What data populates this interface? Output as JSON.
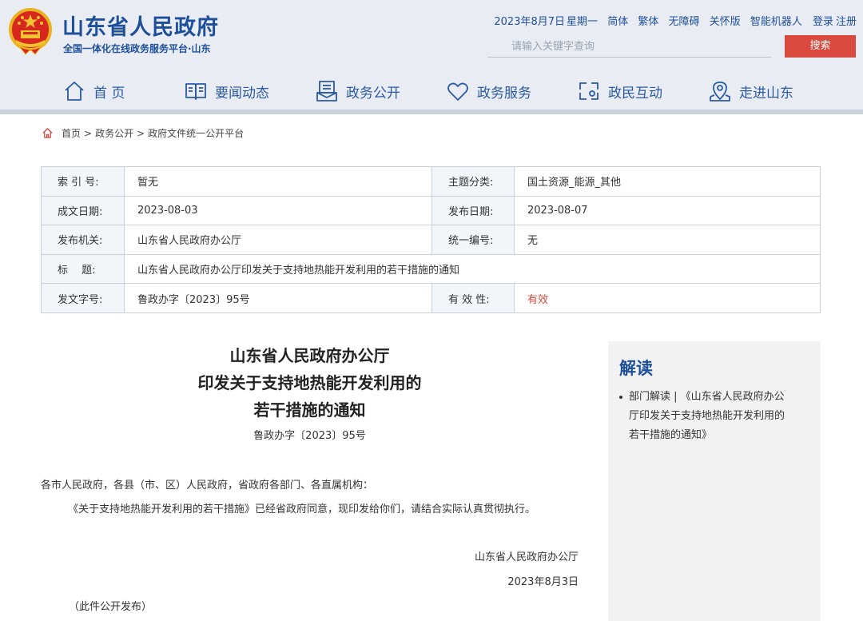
{
  "header": {
    "site_title": "山东省人民政府",
    "site_subtitle": "全国一体化在线政务服务平台·山东",
    "date": "2023年8月7日",
    "weekday": "星期一",
    "links": [
      "简体",
      "繁体",
      "无障碍",
      "关怀版",
      "智能机器人"
    ],
    "login": "登录",
    "register": "注册",
    "search_placeholder": "请输入关键字查询",
    "search_button": "搜索"
  },
  "nav": {
    "items": [
      {
        "label": "首 页",
        "icon": "home-icon"
      },
      {
        "label": "要闻动态",
        "icon": "news-icon"
      },
      {
        "label": "政务公开",
        "icon": "open-gov-icon"
      },
      {
        "label": "政务服务",
        "icon": "heart-service-icon"
      },
      {
        "label": "政民互动",
        "icon": "interaction-icon"
      },
      {
        "label": "走进山东",
        "icon": "location-icon"
      }
    ]
  },
  "breadcrumb": {
    "icon": "home-icon",
    "items": [
      "首页",
      "政务公开",
      "政府文件统一公开平台"
    ],
    "separator": ">"
  },
  "info": {
    "index_label": "索 引 号:",
    "index_value": "暂无",
    "topic_label": "主题分类:",
    "topic_value": "国土资源_能源_其他",
    "written_label": "成文日期:",
    "written_value": "2023-08-03",
    "published_label": "发布日期:",
    "published_value": "2023-08-07",
    "issuer_label": "发布机关:",
    "issuer_value": "山东省人民政府办公厅",
    "serial_label": "统一编号:",
    "serial_value": "无",
    "title_label": "标　 题:",
    "title_value": "山东省人民政府办公厅印发关于支持地热能开发利用的若干措施的通知",
    "docno_label": "发文字号:",
    "docno_value": "鲁政办字〔2023〕95号",
    "validity_label": "有 效 性:",
    "validity_value": "有效",
    "validity_color": "#d9493e"
  },
  "document": {
    "title_line1": "山东省人民政府办公厅",
    "title_line2": "印发关于支持地热能开发利用的",
    "title_line3": "若干措施的通知",
    "number": "鲁政办字〔2023〕95号",
    "addressee": "各市人民政府，各县（市、区）人民政府，省政府各部门、各直属机构：",
    "body": "《关于支持地热能开发利用的若干措施》已经省政府同意，现印发给你们，请结合实际认真贯彻执行。",
    "signer": "山东省人民政府办公厅",
    "date": "2023年8月3日",
    "note": "（此件公开发布）"
  },
  "side": {
    "title": "解读",
    "item_line1": "部门解读 | 《山东省人民政府办公",
    "item_line2": "厅印发关于支持地热能开发利用的",
    "item_line3": "若干措施的通知》"
  },
  "colors": {
    "brand_blue": "#1e4f9a",
    "accent_red": "#d9493e",
    "header_bg": "#e9edf3"
  }
}
